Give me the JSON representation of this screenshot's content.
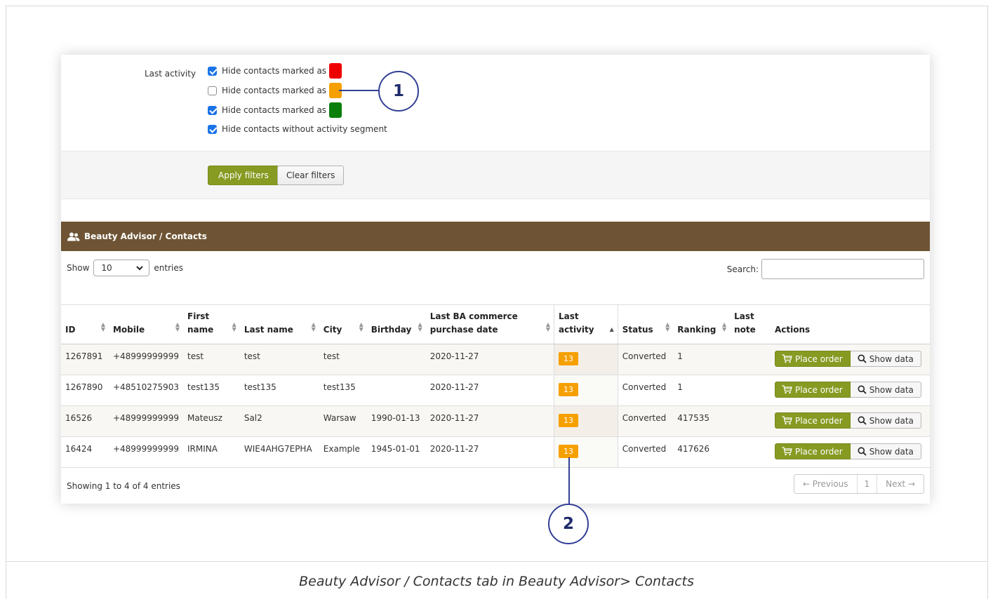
{
  "filters": {
    "label": "Last activity",
    "options": [
      {
        "text": "Hide contacts marked as",
        "checked": true,
        "swatch": "#ee0000"
      },
      {
        "text": "Hide contacts marked as",
        "checked": false,
        "swatch": "#f6a000"
      },
      {
        "text": "Hide contacts marked as",
        "checked": true,
        "swatch": "#0a7f0a"
      },
      {
        "text": "Hide contacts without activity segment",
        "checked": true
      }
    ],
    "apply_label": "Apply filters",
    "clear_label": "Clear filters"
  },
  "panel": {
    "title": "Beauty Advisor / Contacts",
    "show_label": "Show",
    "page_size": "10",
    "entries_label": "entries",
    "search_label": "Search:",
    "search_value": ""
  },
  "table": {
    "headers": [
      "ID",
      "Mobile",
      "First name",
      "Last name",
      "City",
      "Birthday",
      "Last BA commerce purchase date",
      "Last activity",
      "Status",
      "Ranking",
      "Last note",
      "Actions"
    ],
    "rows": [
      {
        "id": "1267891",
        "mobile": "+48999999999",
        "first": "test",
        "last": "test",
        "city": "test",
        "birthday": "",
        "purchase": "2020-11-27",
        "activity": "13",
        "status": "Converted",
        "ranking": "1",
        "note": ""
      },
      {
        "id": "1267890",
        "mobile": "+48510275903",
        "first": "test135",
        "last": "test135",
        "city": "test135",
        "birthday": "",
        "purchase": "2020-11-27",
        "activity": "13",
        "status": "Converted",
        "ranking": "1",
        "note": ""
      },
      {
        "id": "16526",
        "mobile": "+48999999999",
        "first": "Mateusz",
        "last": "Sal2",
        "city": "Warsaw",
        "birthday": "1990-01-13",
        "purchase": "2020-11-27",
        "activity": "13",
        "status": "Converted",
        "ranking": "417535",
        "note": ""
      },
      {
        "id": "16424",
        "mobile": "+48999999999",
        "first": "IRMINA",
        "last": "WIE4AHG7EPHA",
        "city": "Example",
        "birthday": "1945-01-01",
        "purchase": "2020-11-27",
        "activity": "13",
        "status": "Converted",
        "ranking": "417626",
        "note": ""
      }
    ],
    "place_order_label": "Place order",
    "show_data_label": "Show data"
  },
  "footer": {
    "info": "Showing 1 to 4 of 4 entries",
    "prev": "← Previous",
    "page": "1",
    "next": "Next →"
  },
  "callouts": {
    "one": "1",
    "two": "2"
  },
  "caption": "Beauty Advisor / Contacts tab in Beauty Advisor> Contacts",
  "colors": {
    "accent": "#879a22",
    "panel_header": "#6e5434",
    "activity_badge": "#f6a000",
    "callout": "#334095"
  }
}
